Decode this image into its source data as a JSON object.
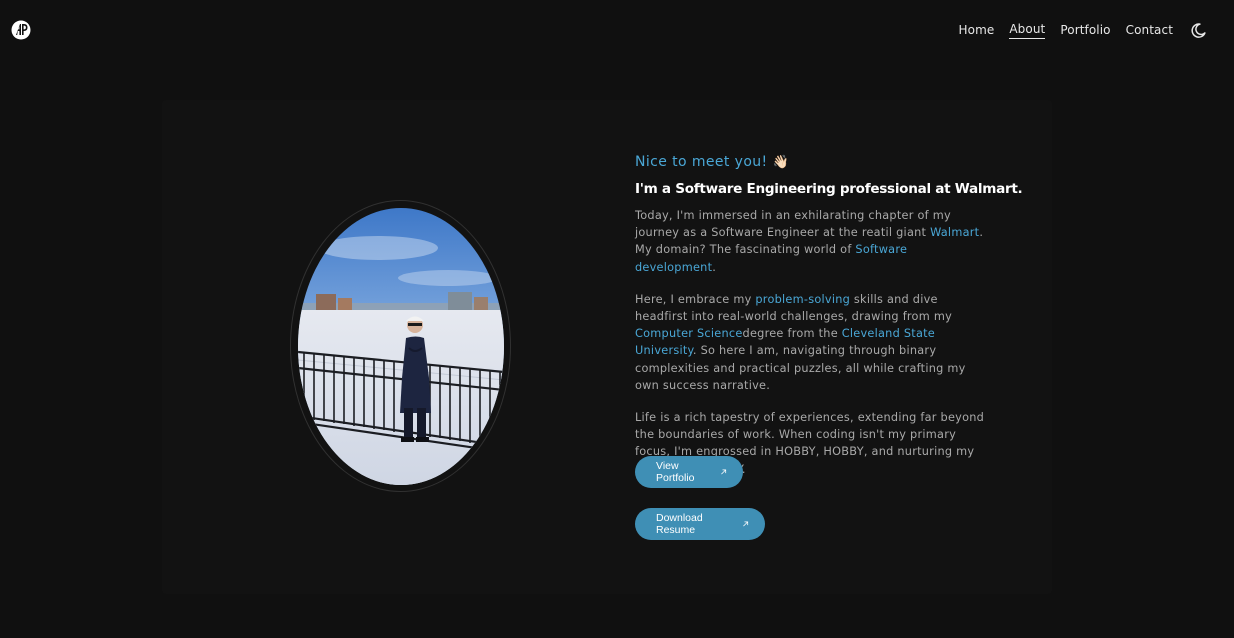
{
  "nav": {
    "items": [
      {
        "label": "Home",
        "active": false
      },
      {
        "label": "About",
        "active": true
      },
      {
        "label": "Portfolio",
        "active": false
      },
      {
        "label": "Contact",
        "active": false
      }
    ],
    "theme_toggle_icon": "moon-icon",
    "logo_icon": "monogram-logo-icon"
  },
  "about": {
    "greeting": "Nice to meet you!",
    "greeting_emoji": "👋🏻",
    "headline": "I'm a Software Engineering professional at Walmart.",
    "p1": {
      "t1": "Today, I'm immersed in an exhilarating chapter of my journey as a Software Engineer at the reatil giant ",
      "link1": "Walmart",
      "t2": ". My domain? The fascinating world of ",
      "link2": "Software development",
      "t3": "."
    },
    "p2": {
      "t1": "Here, I embrace my ",
      "link1": "problem-solving",
      "t2": " skills and dive headfirst into real-world challenges, drawing from my ",
      "link2": "Computer Science",
      "t3": "degree from the ",
      "link3": "Cleveland State University",
      "t4": ". So here I am, navigating through binary complexities and practical puzzles, all while crafting my own success narrative."
    },
    "p3": "Life is a rich tapestry of experiences, extending far beyond the boundaries of work. When coding isn't my primary focus, I'm engrossed in HOBBY, HOBBY, and nurturing my passion for HOBBY.",
    "buttons": {
      "portfolio": "View Portfolio",
      "resume": "Download Resume"
    }
  },
  "colors": {
    "background": "#101010",
    "accent": "#4aa7d6",
    "button": "#3f8fb5",
    "text": "#a9a9a9",
    "heading": "#ffffff"
  }
}
